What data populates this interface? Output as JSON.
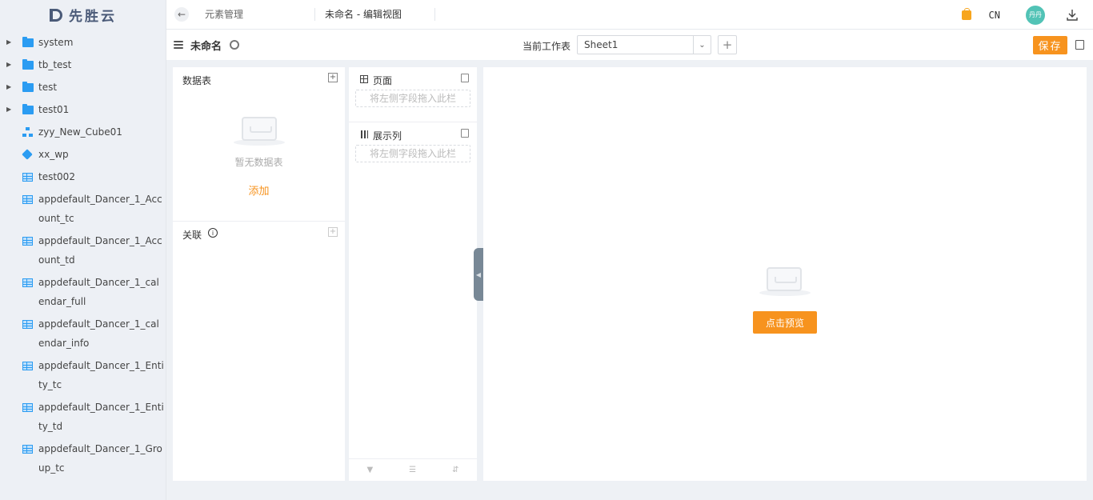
{
  "logo": {
    "text": "先胜云"
  },
  "sidebar": {
    "items": [
      {
        "label": "system",
        "icon": "folder-icon",
        "expandable": true
      },
      {
        "label": "tb_test",
        "icon": "folder-icon",
        "expandable": true
      },
      {
        "label": "test",
        "icon": "folder-icon",
        "expandable": true
      },
      {
        "label": "test01",
        "icon": "folder-icon",
        "expandable": true
      },
      {
        "label": "zyy_New_Cube01",
        "icon": "hierarchy-icon",
        "expandable": false
      },
      {
        "label": "xx_wp",
        "icon": "cube-icon",
        "expandable": false
      },
      {
        "label": "test002",
        "icon": "table-icon",
        "expandable": false
      },
      {
        "label": "appdefault_Dancer_1_Account_tc",
        "icon": "table-icon",
        "expandable": false
      },
      {
        "label": "appdefault_Dancer_1_Account_td",
        "icon": "table-icon",
        "expandable": false
      },
      {
        "label": "appdefault_Dancer_1_calendar_full",
        "icon": "table-icon",
        "expandable": false
      },
      {
        "label": "appdefault_Dancer_1_calendar_info",
        "icon": "table-icon",
        "expandable": false
      },
      {
        "label": "appdefault_Dancer_1_Entity_tc",
        "icon": "table-icon",
        "expandable": false
      },
      {
        "label": "appdefault_Dancer_1_Entity_td",
        "icon": "table-icon",
        "expandable": false
      },
      {
        "label": "appdefault_Dancer_1_Group_tc",
        "icon": "table-icon",
        "expandable": false
      }
    ]
  },
  "topbar": {
    "breadcrumb_parent": "元素管理",
    "breadcrumb_current": "未命名 - 编辑视图",
    "lang": "CN",
    "avatar_text": "丹丹"
  },
  "toolbar": {
    "view_name": "未命名",
    "worksheet_label": "当前工作表",
    "worksheet_value": "Sheet1",
    "add_symbol": "+",
    "save_label": "保存"
  },
  "data_panel": {
    "title": "数据表",
    "empty_text": "暂无数据表",
    "add_link": "添加",
    "relation_title": "关联"
  },
  "fields_panel": {
    "page_title": "页面",
    "page_placeholder": "将左侧字段拖入此栏",
    "columns_title": "展示列",
    "columns_placeholder": "将左侧字段拖入此栏"
  },
  "preview_panel": {
    "preview_button": "点击预览"
  },
  "colors": {
    "accent": "#f7931e",
    "folder": "#2b9cf2",
    "avatar": "#52c3b6",
    "sidebar_bg": "#edf0f5"
  }
}
